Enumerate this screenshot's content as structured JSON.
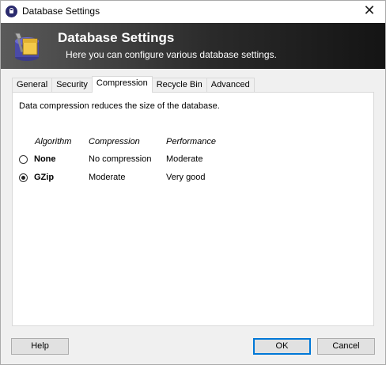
{
  "window": {
    "title": "Database Settings",
    "close_glyph": "✕"
  },
  "banner": {
    "title": "Database Settings",
    "subtitle": "Here you can configure various database settings.",
    "icon": "database-settings-icon"
  },
  "tabs": [
    {
      "label": "General",
      "active": false
    },
    {
      "label": "Security",
      "active": false
    },
    {
      "label": "Compression",
      "active": true
    },
    {
      "label": "Recycle Bin",
      "active": false
    },
    {
      "label": "Advanced",
      "active": false
    }
  ],
  "compression": {
    "description": "Data compression reduces the size of the database.",
    "columns": [
      "Algorithm",
      "Compression",
      "Performance"
    ],
    "options": [
      {
        "algorithm": "None",
        "compression": "No compression",
        "performance": "Moderate",
        "selected": false
      },
      {
        "algorithm": "GZip",
        "compression": "Moderate",
        "performance": "Very good",
        "selected": true
      }
    ]
  },
  "buttons": {
    "help": "Help",
    "ok": "OK",
    "cancel": "Cancel"
  },
  "colors": {
    "banner_dark": "#141414",
    "default_button_border": "#0078d7"
  }
}
